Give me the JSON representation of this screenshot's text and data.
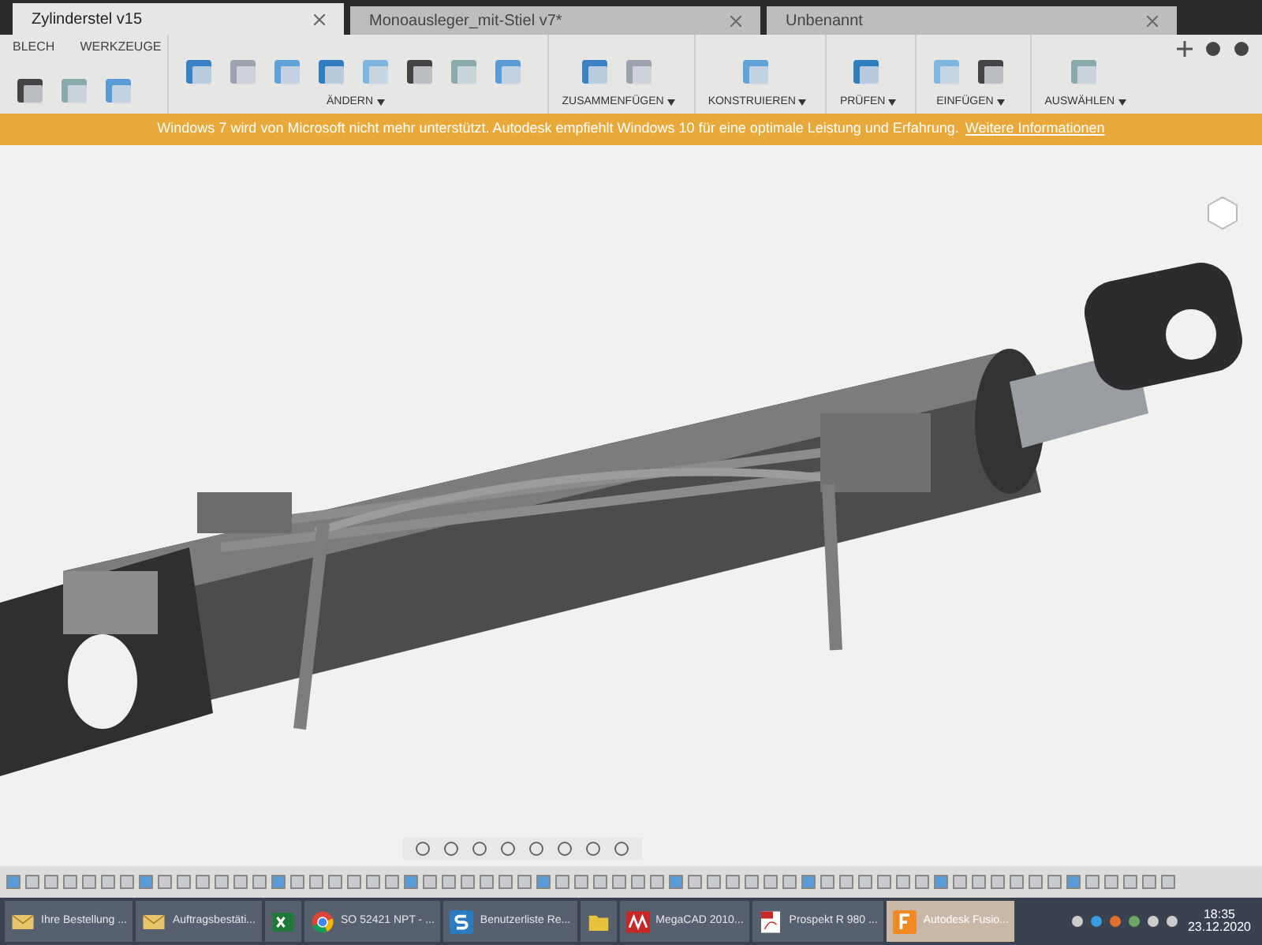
{
  "document_tabs": [
    {
      "label": "Zylinderstel v15",
      "selected": true
    },
    {
      "label": "Monoausleger_mit-Stiel v7*",
      "selected": false
    },
    {
      "label": "Unbenannt",
      "selected": false
    }
  ],
  "ribbon_tabs": [
    {
      "label": "BLECH",
      "selected": false
    },
    {
      "label": "WERKZEUGE",
      "selected": false
    }
  ],
  "ribbon_groups": [
    {
      "label": "ÄNDERN"
    },
    {
      "label": "ZUSAMMENFÜGEN"
    },
    {
      "label": "KONSTRUIEREN"
    },
    {
      "label": "PRÜFEN"
    },
    {
      "label": "EINFÜGEN"
    },
    {
      "label": "AUSWÄHLEN"
    }
  ],
  "banner": {
    "text": "Windows 7 wird von Microsoft nicht mehr unterstützt. Autodesk empfiehlt Windows 10 für eine optimale Leistung und Erfahrung.",
    "link": "Weitere Informationen"
  },
  "taskbar": {
    "items": [
      {
        "label": "Ihre Bestellung ...",
        "kind": "mail",
        "selected": false
      },
      {
        "label": "Auftragsbestäti...",
        "kind": "mail",
        "selected": false
      },
      {
        "kind": "excel",
        "selected": false
      },
      {
        "label": "SO 52421 NPT - ...",
        "kind": "chrome",
        "selected": false
      },
      {
        "label": "Benutzerliste Re...",
        "kind": "s",
        "selected": false
      },
      {
        "kind": "folder",
        "selected": false
      },
      {
        "label": "MegaCAD 2010...",
        "kind": "megacad",
        "selected": false
      },
      {
        "label": "Prospekt R 980 ...",
        "kind": "pdf",
        "selected": false
      },
      {
        "label": "Autodesk Fusio...",
        "kind": "fusion",
        "selected": true
      }
    ],
    "time": "18:35",
    "date": "23.12.2020"
  }
}
